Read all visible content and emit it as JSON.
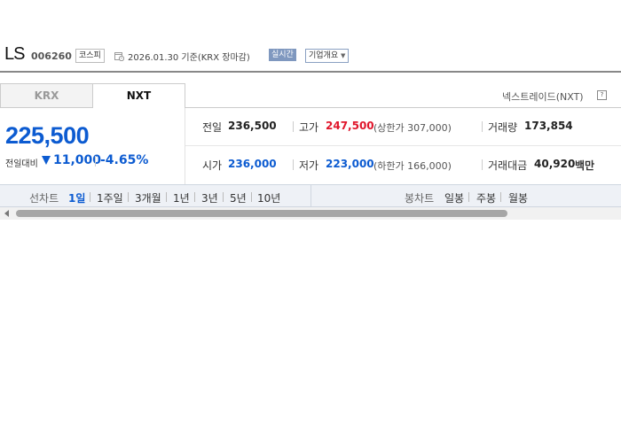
{
  "header": {
    "stock_name": "LS",
    "stock_code": "006260",
    "market_badge": "코스피",
    "date_text": "2026.01.30 기준(KRX 장마감)",
    "realtime_badge": "실시간",
    "company_info_button": "기업개요"
  },
  "tabs": [
    {
      "label": "KRX",
      "active": false
    },
    {
      "label": "NXT",
      "active": true
    }
  ],
  "nxt_link": "넥스트레이드(NXT)",
  "help_icon": "?",
  "price": {
    "current": "225,500",
    "change_label": "전일대비",
    "change_icon": "down-triangle-icon",
    "change_amount": "11,000",
    "change_percent": "-4.65%"
  },
  "stats": {
    "prev_close_label": "전일",
    "prev_close": "236,500",
    "high_label": "고가",
    "high": "247,500",
    "upper_limit": "(상한가 307,000)",
    "volume_label": "거래량",
    "volume": "173,854",
    "open_label": "시가",
    "open": "236,000",
    "low_label": "저가",
    "low": "223,000",
    "lower_limit": "(하한가 166,000)",
    "amount_label": "거래대금",
    "amount": "40,920",
    "amount_unit": "백만"
  },
  "line_chart": {
    "label": "선차트",
    "periods": [
      "1일",
      "1주일",
      "3개월",
      "1년",
      "3년",
      "5년",
      "10년"
    ],
    "selected": "1일"
  },
  "candle_chart": {
    "label": "봉차트",
    "periods": [
      "일봉",
      "주봉",
      "월봉"
    ]
  },
  "colors": {
    "down": "#0c5bd1",
    "up": "#e0162b"
  }
}
